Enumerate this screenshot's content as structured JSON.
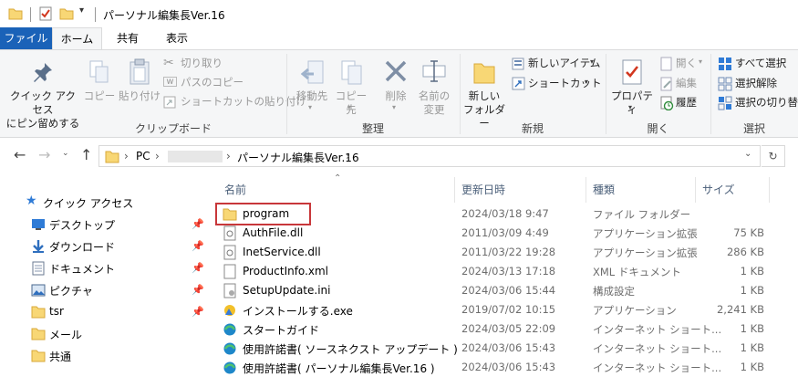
{
  "window": {
    "title": "パーソナル編集長Ver.16"
  },
  "tabs": {
    "file": "ファイル",
    "home": "ホーム",
    "share": "共有",
    "view": "表示"
  },
  "ribbon": {
    "clipboard": {
      "label": "クリップボード",
      "pin_quick_access": "クイック アクセス\nにピン留めする",
      "pin_line1": "クイック アクセス",
      "pin_line2": "にピン留めする",
      "copy": "コピー",
      "paste": "貼り付け",
      "cut": "切り取り",
      "copy_path": "パスのコピー",
      "paste_shortcut": "ショートカットの貼り付け"
    },
    "organize": {
      "label": "整理",
      "move_to": "移動先",
      "copy_to": "コピー先",
      "delete": "削除",
      "rename_line1": "名前の",
      "rename_line2": "変更"
    },
    "new": {
      "label": "新規",
      "new_folder_line1": "新しい",
      "new_folder_line2": "フォルダー",
      "new_item": "新しいアイテム",
      "shortcut": "ショートカット"
    },
    "open": {
      "label": "開く",
      "properties": "プロパティ",
      "open": "開く",
      "edit": "編集",
      "history": "履歴"
    },
    "select": {
      "label": "選択",
      "select_all": "すべて選択",
      "select_none": "選択解除",
      "invert": "選択の切り替え"
    }
  },
  "address": {
    "segments": [
      "PC",
      "パーソナル編集長Ver.16"
    ],
    "hidden_segment_note": ""
  },
  "nav": {
    "items": [
      {
        "label": "クイック アクセス",
        "icon": "star-icon",
        "pinned": false
      },
      {
        "label": "デスクトップ",
        "icon": "desktop-icon",
        "pinned": true
      },
      {
        "label": "ダウンロード",
        "icon": "download-icon",
        "pinned": true
      },
      {
        "label": "ドキュメント",
        "icon": "document-icon",
        "pinned": true
      },
      {
        "label": "ピクチャ",
        "icon": "picture-icon",
        "pinned": true
      },
      {
        "label": "tsr",
        "icon": "folder-icon",
        "pinned": true
      },
      {
        "label": "メール",
        "icon": "folder-icon",
        "pinned": false
      },
      {
        "label": "共通",
        "icon": "folder-icon",
        "pinned": false
      }
    ]
  },
  "columns": {
    "name": "名前",
    "modified": "更新日時",
    "type": "種類",
    "size": "サイズ"
  },
  "files": [
    {
      "name": "program",
      "modified": "2024/03/18 9:47",
      "type": "ファイル フォルダー",
      "size": "",
      "icon": "folder-icon"
    },
    {
      "name": "AuthFile.dll",
      "modified": "2011/03/09 4:49",
      "type": "アプリケーション拡張",
      "size": "75 KB",
      "icon": "dll-icon"
    },
    {
      "name": "InetService.dll",
      "modified": "2011/03/22 19:28",
      "type": "アプリケーション拡張",
      "size": "286 KB",
      "icon": "dll-icon"
    },
    {
      "name": "ProductInfo.xml",
      "modified": "2024/03/13 17:18",
      "type": "XML ドキュメント",
      "size": "1 KB",
      "icon": "xml-icon"
    },
    {
      "name": "SetupUpdate.ini",
      "modified": "2024/03/06 15:44",
      "type": "構成設定",
      "size": "1 KB",
      "icon": "ini-icon"
    },
    {
      "name": "インストールする.exe",
      "modified": "2019/07/02 10:15",
      "type": "アプリケーション",
      "size": "2,241 KB",
      "icon": "exe-icon"
    },
    {
      "name": "スタートガイド",
      "modified": "2024/03/05 22:09",
      "type": "インターネット ショート...",
      "size": "1 KB",
      "icon": "url-icon"
    },
    {
      "name": "使用許諾書( ソースネクスト アップデート )",
      "modified": "2024/03/06 15:43",
      "type": "インターネット ショート...",
      "size": "1 KB",
      "icon": "url-icon"
    },
    {
      "name": "使用許諾書( パーソナル編集長Ver.16 )",
      "modified": "2024/03/06 15:43",
      "type": "インターネット ショート...",
      "size": "1 KB",
      "icon": "url-icon"
    }
  ]
}
